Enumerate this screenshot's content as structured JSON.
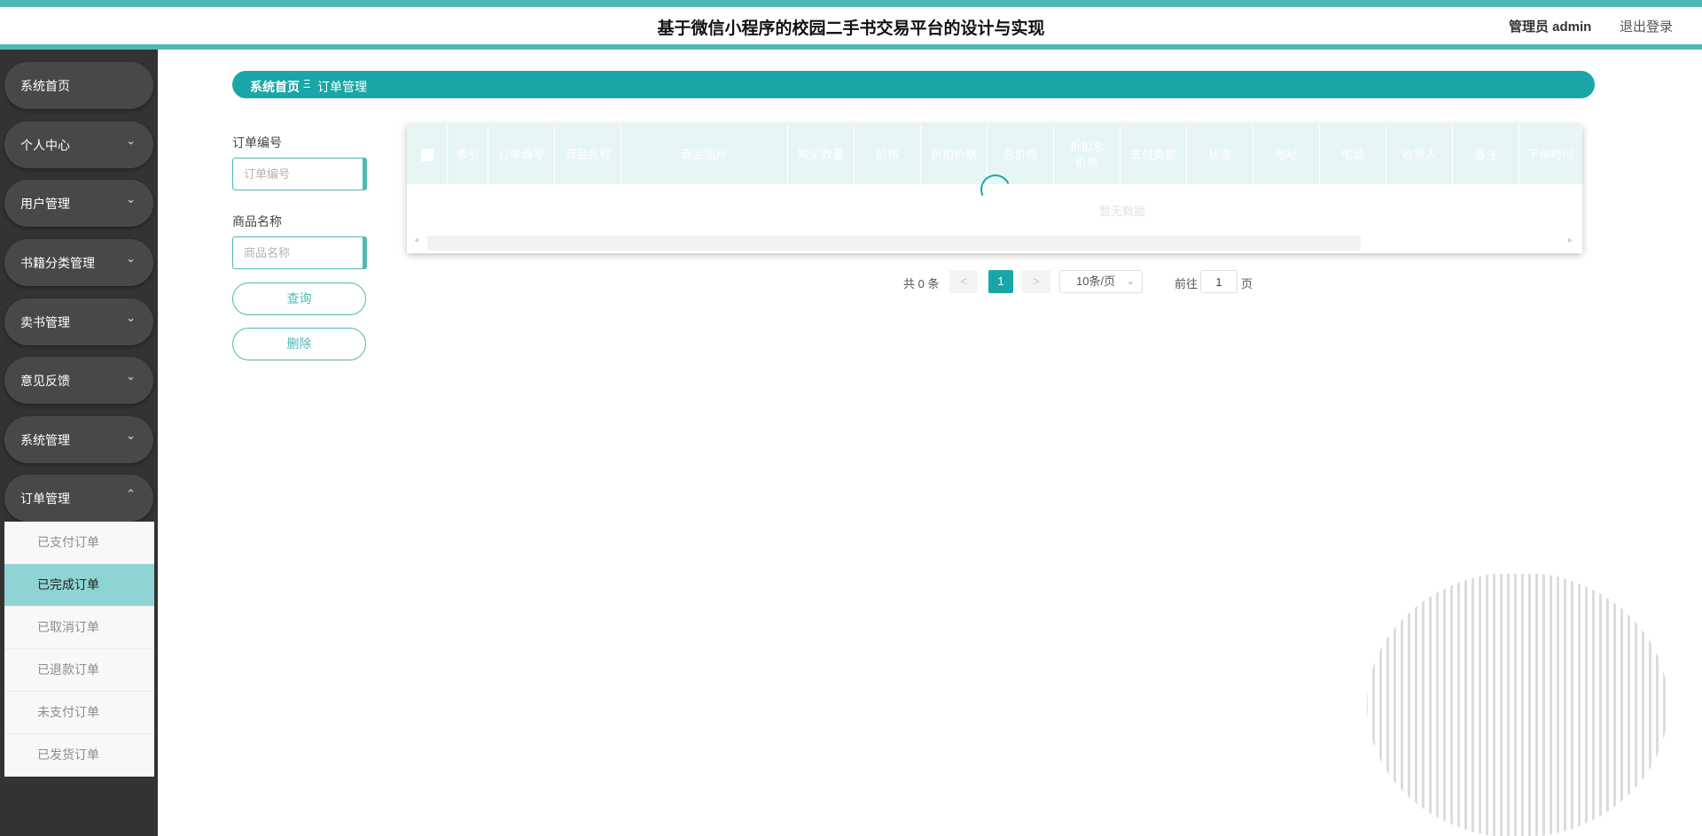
{
  "header": {
    "title": "基于微信小程序的校园二手书交易平台的设计与实现",
    "admin_label": "管理员 admin",
    "logout_label": "退出登录"
  },
  "sidebar": {
    "items": [
      {
        "label": "系统首页",
        "icon": "none"
      },
      {
        "label": "个人中心",
        "icon": "chevron-down-icon"
      },
      {
        "label": "用户管理",
        "icon": "chevron-down-icon"
      },
      {
        "label": "书籍分类管理",
        "icon": "chevron-down-icon"
      },
      {
        "label": "卖书管理",
        "icon": "chevron-down-icon"
      },
      {
        "label": "意见反馈",
        "icon": "chevron-down-icon"
      },
      {
        "label": "系统管理",
        "icon": "chevron-down-icon"
      },
      {
        "label": "订单管理",
        "icon": "chevron-up-icon"
      }
    ],
    "chevron_down": "⌄",
    "chevron_up": "⌃",
    "submenu": [
      {
        "label": "已支付订单",
        "active": false
      },
      {
        "label": "已完成订单",
        "active": true
      },
      {
        "label": "已取消订单",
        "active": false
      },
      {
        "label": "已退款订单",
        "active": false
      },
      {
        "label": "未支付订单",
        "active": false
      },
      {
        "label": "已发货订单",
        "active": false
      }
    ]
  },
  "breadcrumb": {
    "home": "系统首页",
    "separator": "Ξ",
    "current": "订单管理"
  },
  "search": {
    "order_no_label": "订单编号",
    "order_no_placeholder": "订单编号",
    "order_no_value": "",
    "product_label": "商品名称",
    "product_placeholder": "商品名称",
    "product_value": "",
    "query_button": "查询",
    "delete_button": "删除"
  },
  "table": {
    "columns": [
      "索引",
      "订单编号",
      "商品名称",
      "商品图片",
      "购买数量",
      "价格",
      "折扣价格",
      "总价格",
      "折扣总价格",
      "支付类型",
      "状态",
      "地址",
      "电话",
      "收货人",
      "备注",
      "下单时间"
    ],
    "empty_text": "暂无数据",
    "rows": []
  },
  "pagination": {
    "total": "共 0 条",
    "prev": "<",
    "current_page": "1",
    "next": ">",
    "page_size": "10条/页",
    "goto_label": "前往",
    "goto_value": "1",
    "page_suffix": "页"
  },
  "colors": {
    "accent": "#1aa6a6",
    "header_border": "#4fb8b3",
    "sidebar_bg": "#333333",
    "nav_item_bg": "#4a4847",
    "submenu_active": "#8ed4d3",
    "table_header_bg": "#e6f6f5"
  }
}
